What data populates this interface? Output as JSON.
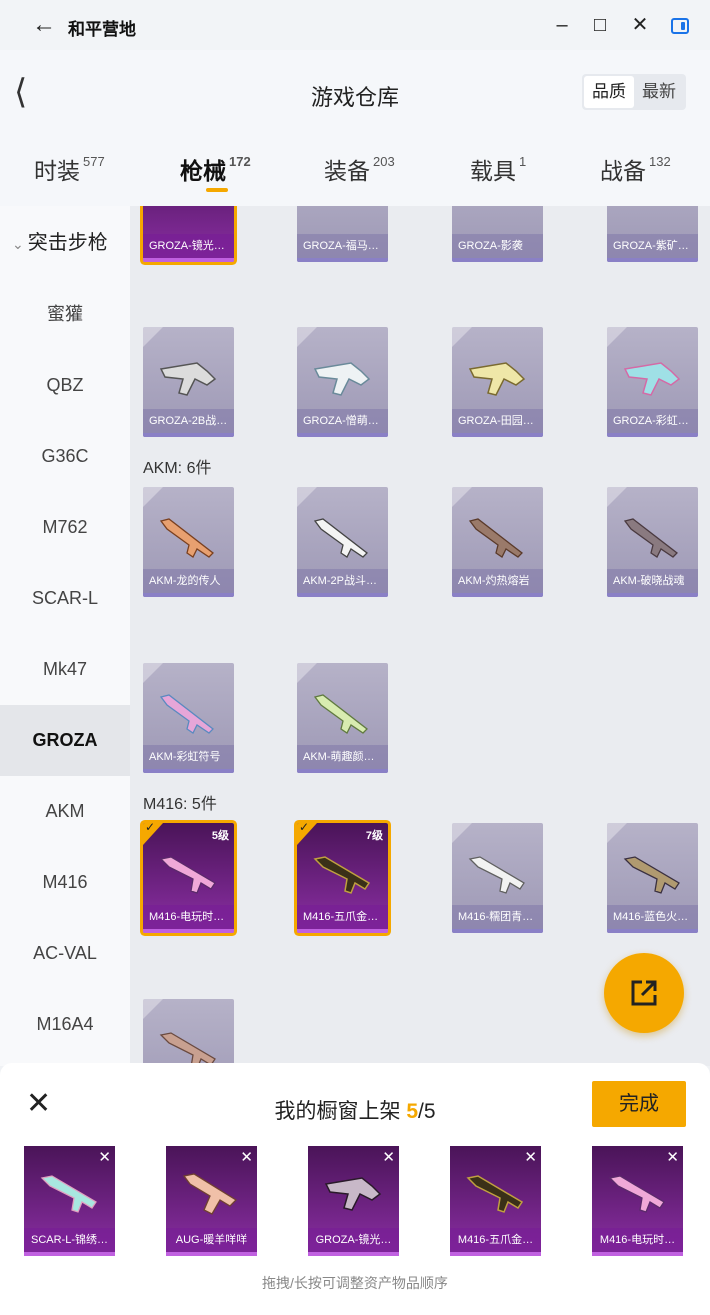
{
  "window": {
    "back_icon": "arrow-left-icon",
    "title": "和平营地",
    "minimize": "–",
    "maximize": "□",
    "close": "✕"
  },
  "header": {
    "back_icon": "chevron-left-icon",
    "title": "游戏仓库",
    "sort_options": [
      "品质",
      "最新"
    ],
    "sort_selected": "品质"
  },
  "tabs": [
    {
      "label": "时装",
      "count": "577"
    },
    {
      "label": "枪械",
      "count": "172",
      "active": true
    },
    {
      "label": "装备",
      "count": "203"
    },
    {
      "label": "载具",
      "count": "1"
    },
    {
      "label": "战备",
      "count": "132"
    }
  ],
  "sidebar": {
    "group": "突击步枪",
    "items": [
      "蜜獾",
      "QBZ",
      "G36C",
      "M762",
      "SCAR-L",
      "Mk47",
      "GROZA",
      "AKM",
      "M416",
      "AC-VAL",
      "M16A4"
    ],
    "active": "GROZA"
  },
  "grid": {
    "groza_row1": [
      "GROZA-镜光…",
      "GROZA-福马…",
      "GROZA-影袭",
      "GROZA-紫矿…"
    ],
    "groza_row2": [
      "GROZA-2B战…",
      "GROZA-憎萌…",
      "GROZA-田园…",
      "GROZA-彩虹…"
    ],
    "akm_label": "AKM: 6件",
    "akm_row1": [
      "AKM-龙的传人",
      "AKM-2P战斗…",
      "AKM-灼热熔岩",
      "AKM-破晓战魂"
    ],
    "akm_row2": [
      "AKM-彩虹符号",
      "AKM-萌趣颜…"
    ],
    "m416_label": "M416: 5件",
    "m416_row1": [
      "M416-电玩时…",
      "M416-五爪金…",
      "M416-糯团青…",
      "M416-蓝色火…"
    ],
    "m416_levels": [
      "5级",
      "7级"
    ]
  },
  "panel": {
    "title_prefix": "我的橱窗上架 ",
    "count": "5",
    "total": "/5",
    "done_label": "完成",
    "items": [
      "SCAR-L-锦绣…",
      "AUG-暖羊咩咩",
      "GROZA-镜光…",
      "M416-五爪金…",
      "M416-电玩时…"
    ],
    "hint": "拖拽/长按可调整资产物品顺序"
  },
  "colors": {
    "accent": "#f5a800",
    "epic_purple": "#8c2fa5",
    "card_gray": "#a5a0bb"
  }
}
